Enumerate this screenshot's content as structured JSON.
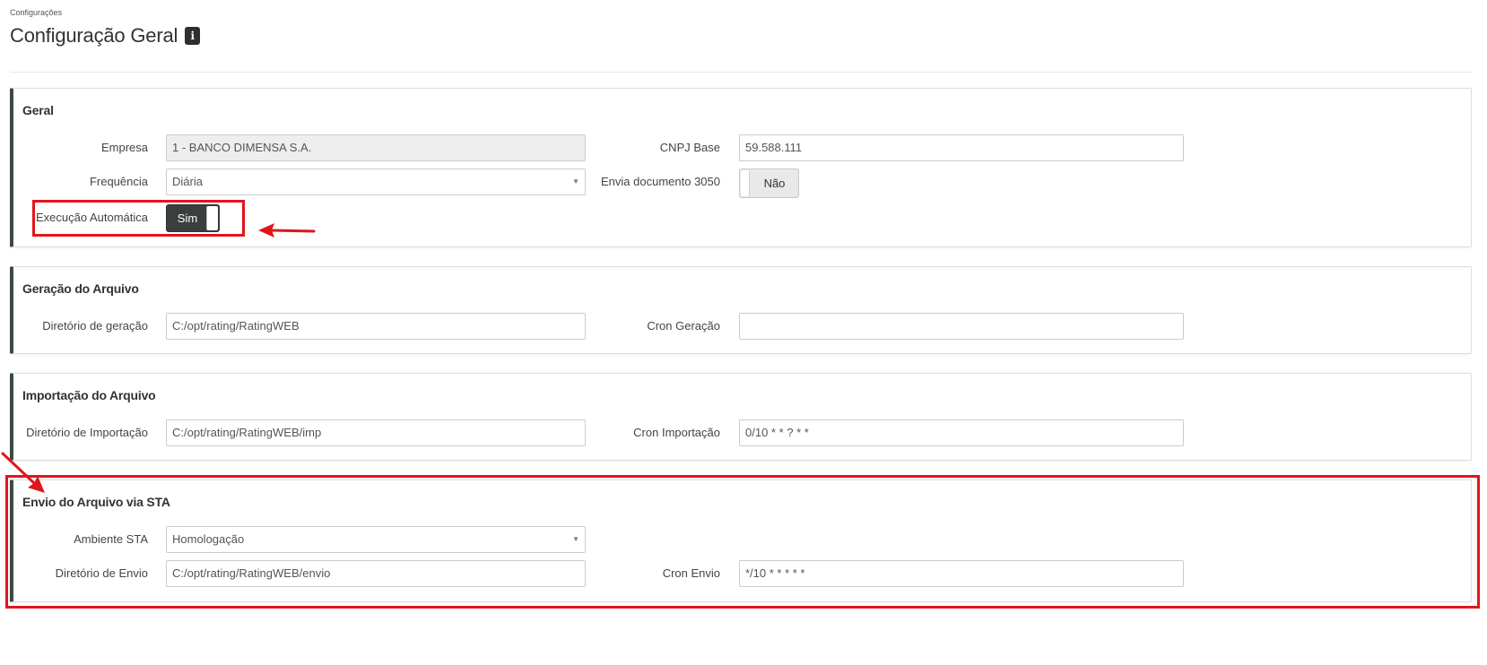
{
  "breadcrumb": "Configurações",
  "page_title": "Configuração Geral",
  "info_icon_glyph": "i",
  "sections": {
    "geral": {
      "title": "Geral",
      "empresa_label": "Empresa",
      "empresa_value": "1 - BANCO DIMENSA S.A.",
      "cnpj_label": "CNPJ Base",
      "cnpj_value": "59.588.111",
      "frequencia_label": "Frequência",
      "frequencia_value": "Diária",
      "envia_label": "Envia documento 3050",
      "envia_value": "Não",
      "execucao_label": "Execução Automática",
      "execucao_value": "Sim"
    },
    "geracao": {
      "title": "Geração do Arquivo",
      "diretorio_label": "Diretório de geração",
      "diretorio_value": "C:/opt/rating/RatingWEB",
      "cron_label": "Cron Geração",
      "cron_value": ""
    },
    "importacao": {
      "title": "Importação do Arquivo",
      "diretorio_label": "Diretório de Importação",
      "diretorio_value": "C:/opt/rating/RatingWEB/imp",
      "cron_label": "Cron Importação",
      "cron_value": "0/10 * * ? * *"
    },
    "envio": {
      "title": "Envio do Arquivo via STA",
      "ambiente_label": "Ambiente STA",
      "ambiente_value": "Homologação",
      "diretorio_label": "Diretório de Envio",
      "diretorio_value": "C:/opt/rating/RatingWEB/envio",
      "cron_label": "Cron Envio",
      "cron_value": "*/10 * * * * *"
    }
  },
  "colors": {
    "annotation_red": "#e0161b",
    "panel_accent": "#3c4a44",
    "toggle_on": "#3a3f3d"
  }
}
